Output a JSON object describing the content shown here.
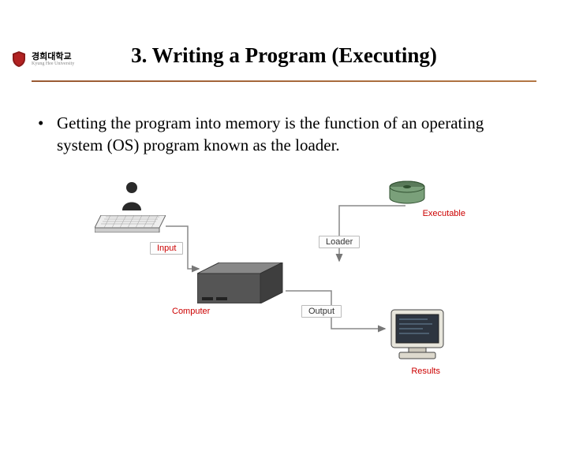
{
  "header": {
    "university_name": "경희대학교",
    "university_en": "Kyung Hee University"
  },
  "title": "3. Writing a Program (Executing)",
  "bullet_text": "Getting the program into memory is the function of an operating system (OS) program known as the loader.",
  "diagram": {
    "input_label": "Input",
    "computer_label": "Computer",
    "loader_label": "Loader",
    "executable_label": "Executable",
    "output_label": "Output",
    "results_label": "Results",
    "label_color_red": "#cc0000",
    "label_color_dark": "#333333"
  }
}
